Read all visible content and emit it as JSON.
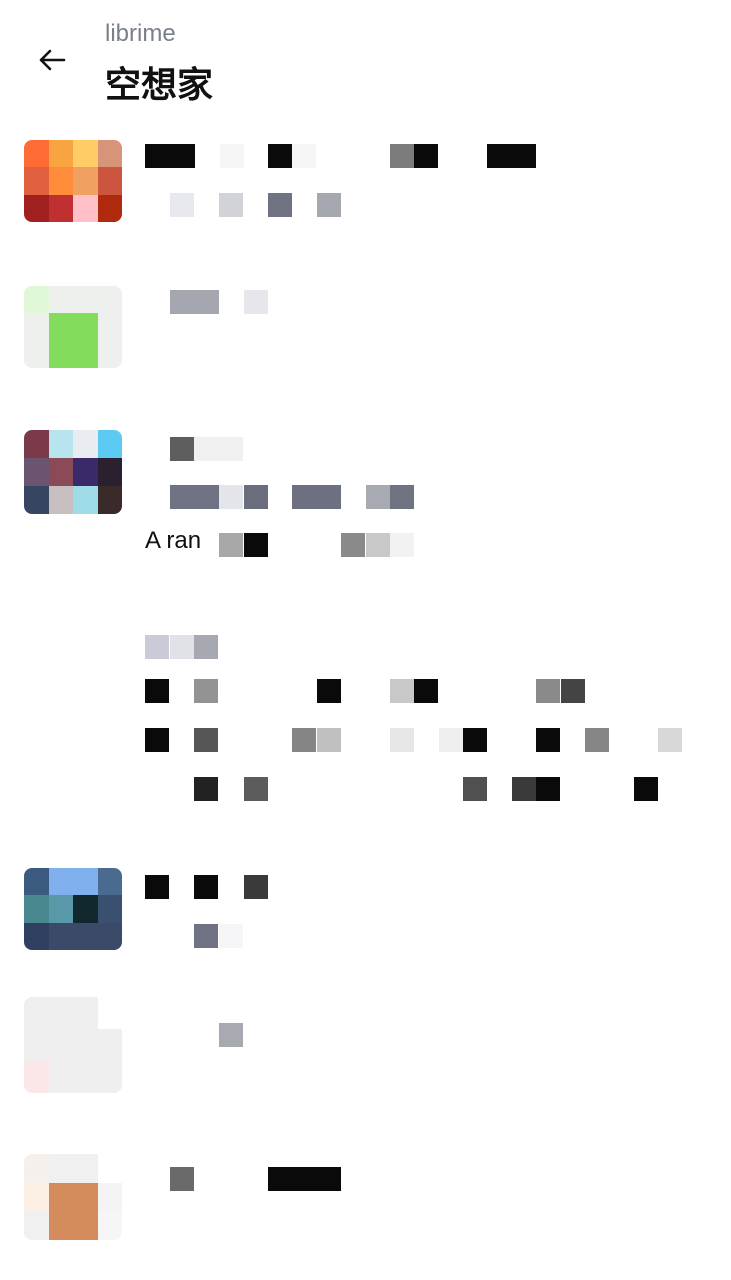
{
  "header": {
    "subtitle": "librime",
    "title": "空想家",
    "back_icon": "arrow-left-icon"
  },
  "posts": [
    {
      "kind": "user",
      "avatar_colors": [
        "#ff6b35",
        "#f7a441",
        "#ffcc66",
        "#d89478",
        "#e06040",
        "#ff8c3a",
        "#f0a060",
        "#cc5540",
        "#a02020",
        "#c03030",
        "#ffc0c8",
        "#b02a10"
      ],
      "name_blocks": [
        [
          145,
          50,
          "#0a0a0a"
        ],
        [
          220,
          24,
          "#f5f5f5"
        ],
        [
          268,
          24,
          "#0a0a0a"
        ],
        [
          292,
          24,
          "#f6f6f6"
        ],
        [
          390,
          24,
          "#7c7c7c"
        ],
        [
          414,
          24,
          "#0a0a0a"
        ],
        [
          487,
          49,
          "#0a0a0a"
        ]
      ],
      "sub_blocks": [
        [
          170,
          24,
          "#e7e9ee"
        ],
        [
          219,
          24,
          "#d1d3d9"
        ],
        [
          268,
          24,
          "#6f7280"
        ],
        [
          317,
          24,
          "#a6a8b0"
        ]
      ]
    },
    {
      "kind": "user",
      "avatar_colors": [
        "#e0f8d8",
        "#eef0ee",
        "#eef0ee",
        "#eef0ee",
        "#eef0ee",
        "#84dc5c",
        "#84dc5c",
        "#eef0ee",
        "#eef0ee",
        "#84dc5c",
        "#84dc5c",
        "#eef0ee"
      ],
      "name_blocks": [
        [
          170,
          49,
          "#a4a7b0"
        ],
        [
          244,
          24,
          "#e6e7ec"
        ]
      ],
      "sub_blocks": []
    },
    {
      "kind": "user",
      "avatar_colors": [
        "#7a3a4a",
        "#b8e4f0",
        "#e9edf2",
        "#5ccaf2",
        "#6a5470",
        "#8a4a58",
        "#3a2a6a",
        "#2a2030",
        "#364660",
        "#c8c0c0",
        "#a0dce8",
        "#3a2a2a"
      ],
      "name_blocks": [
        [
          170,
          24,
          "#5e5e5e"
        ],
        [
          194,
          49,
          "#f0f0f0"
        ]
      ],
      "sub_blocks": [
        [
          170,
          49,
          "#6f7282"
        ],
        [
          219,
          24,
          "#e4e5ea"
        ],
        [
          244,
          24,
          "#6a6d7c"
        ],
        [
          292,
          49,
          "#6d7080"
        ],
        [
          366,
          24,
          "#a8aab2"
        ],
        [
          390,
          24,
          "#6f7280"
        ]
      ],
      "text": "A ran",
      "text_blocks": [
        [
          219,
          24,
          "#a8a8a8"
        ],
        [
          244,
          24,
          "#0a0a0a"
        ],
        [
          341,
          24,
          "#8a8a8a"
        ],
        [
          366,
          24,
          "#c8c8c8"
        ],
        [
          390,
          24,
          "#f2f2f2"
        ]
      ]
    },
    {
      "kind": "text",
      "small_label": "",
      "small_blocks": [
        [
          145,
          24,
          "#c9ccd6"
        ],
        [
          170,
          24,
          "#e0e2e8"
        ],
        [
          194,
          24,
          "#a6a9b2"
        ]
      ],
      "rows": [
        [
          [
            145,
            24,
            "#0a0a0a"
          ],
          [
            194,
            24,
            "#939393"
          ],
          [
            317,
            24,
            "#0a0a0a"
          ],
          [
            390,
            24,
            "#c8c8c8"
          ],
          [
            414,
            24,
            "#0a0a0a"
          ],
          [
            536,
            24,
            "#8a8a8a"
          ],
          [
            561,
            24,
            "#444444"
          ]
        ],
        [
          [
            145,
            24,
            "#0a0a0a"
          ],
          [
            194,
            24,
            "#555555"
          ],
          [
            292,
            24,
            "#858585"
          ],
          [
            317,
            24,
            "#c0c0c0"
          ],
          [
            390,
            24,
            "#e6e6e6"
          ],
          [
            439,
            24,
            "#efefef"
          ],
          [
            463,
            24,
            "#0a0a0a"
          ],
          [
            536,
            24,
            "#0a0a0a"
          ],
          [
            585,
            24,
            "#868686"
          ],
          [
            658,
            24,
            "#d8d8d8"
          ]
        ],
        [
          [
            194,
            24,
            "#222222"
          ],
          [
            244,
            24,
            "#5c5c5c"
          ],
          [
            463,
            24,
            "#505050"
          ],
          [
            512,
            24,
            "#3a3a3a"
          ],
          [
            536,
            24,
            "#0a0a0a"
          ],
          [
            634,
            24,
            "#0a0a0a"
          ]
        ]
      ]
    },
    {
      "kind": "user",
      "avatar_colors": [
        "#3a5a80",
        "#80b0ee",
        "#80b0ee",
        "#4a6a90",
        "#4a8890",
        "#5898a8",
        "#10282e",
        "#3a5070",
        "#304060",
        "#3a4a68",
        "#3a4a68",
        "#3a4a68"
      ],
      "name_blocks": [
        [
          145,
          24,
          "#0a0a0a"
        ],
        [
          194,
          24,
          "#0a0a0a"
        ],
        [
          244,
          24,
          "#3a3a3a"
        ]
      ],
      "sub_blocks": [
        [
          194,
          24,
          "#6f7282"
        ],
        [
          219,
          24,
          "#f6f6f8"
        ]
      ]
    },
    {
      "kind": "user",
      "avatar_colors": [
        "#efefef",
        "#efefef",
        "#efefef",
        "#ffffff",
        "#efefef",
        "#efefef",
        "#efefef",
        "#efefef",
        "#fbe7e7",
        "#efefef",
        "#efefef",
        "#efefef"
      ],
      "name_blocks": [
        [
          219,
          24,
          "#a8aab2"
        ]
      ],
      "sub_blocks": []
    },
    {
      "kind": "user",
      "avatar_colors": [
        "#f6f0ec",
        "#f0f0f0",
        "#f0f0f0",
        "#ffffff",
        "#fcefe4",
        "#d48c5c",
        "#d48c5c",
        "#f4f4f4",
        "#f0f0f0",
        "#d48c5c",
        "#d48c5c",
        "#f6f6f6"
      ],
      "name_blocks": [
        [
          170,
          24,
          "#6a6a6a"
        ],
        [
          268,
          73,
          "#0a0a0a"
        ]
      ],
      "sub_blocks": []
    }
  ]
}
